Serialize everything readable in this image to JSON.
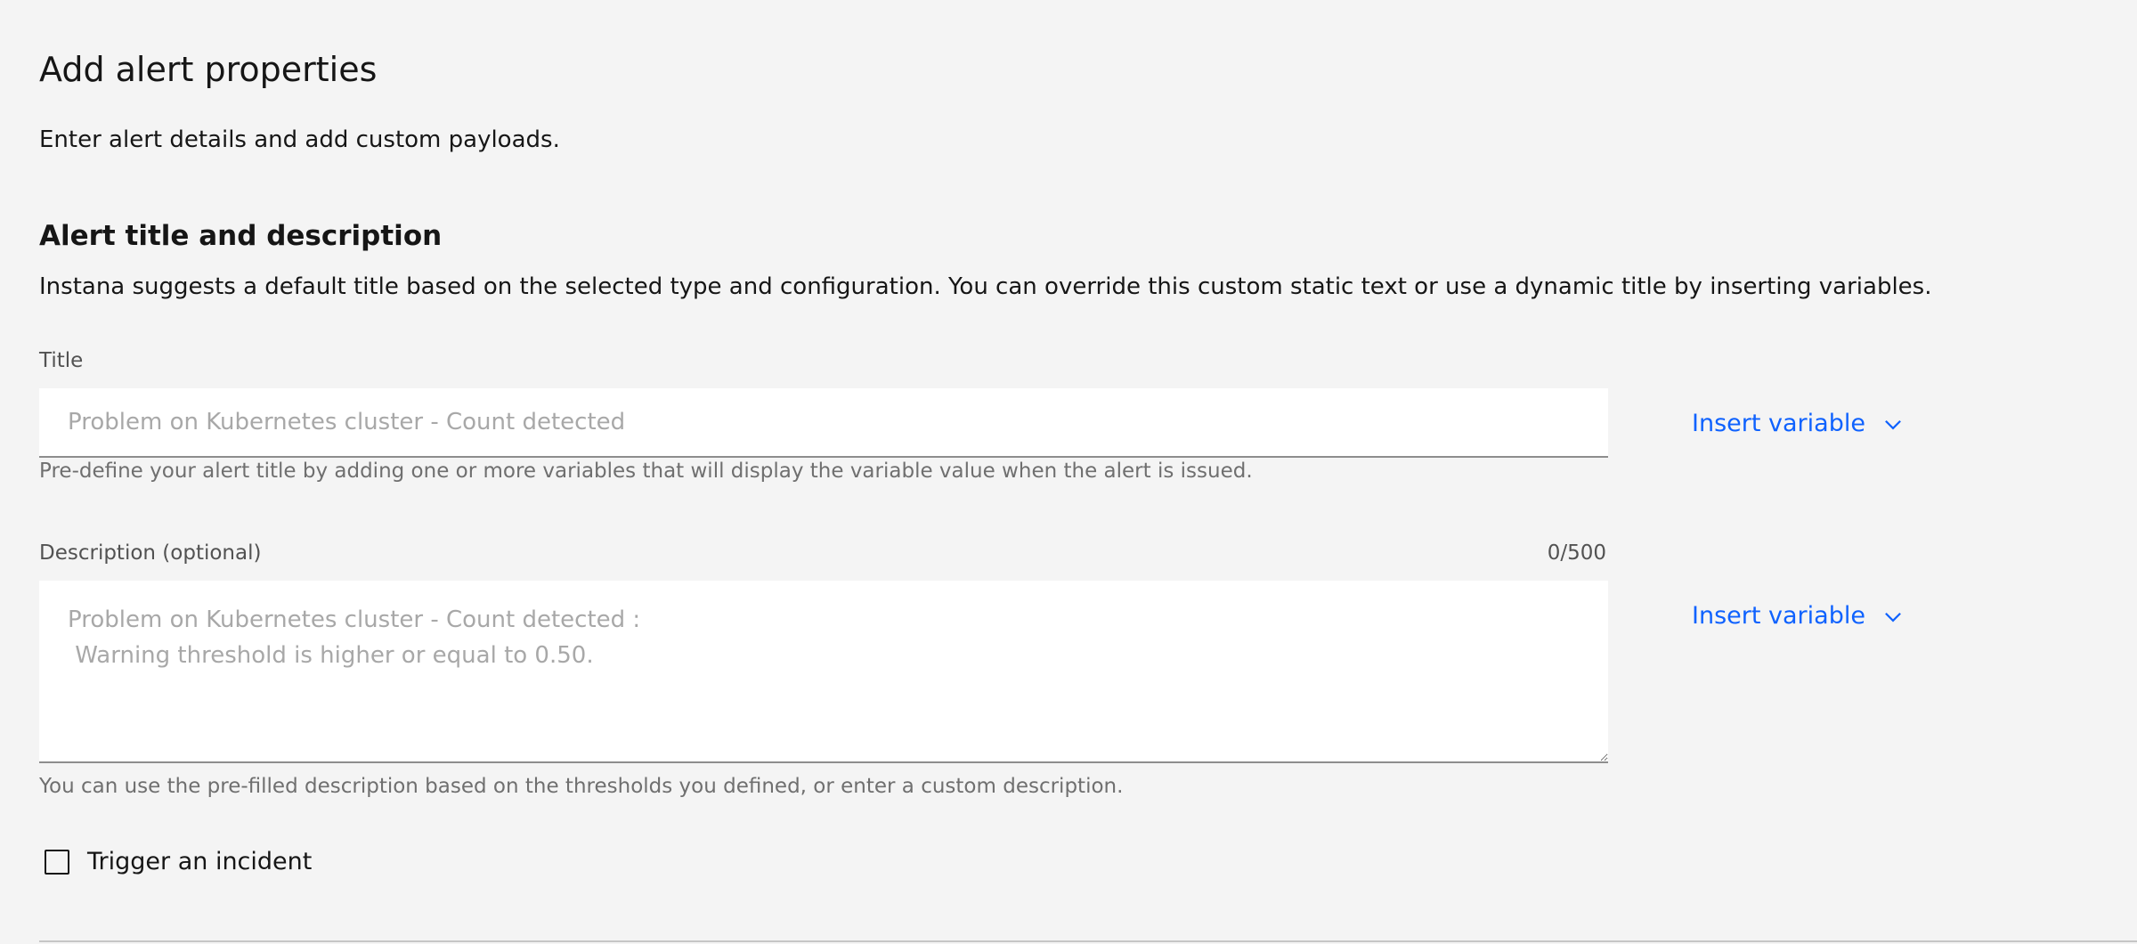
{
  "header": {
    "title": "Add alert properties",
    "subtitle": "Enter alert details and add custom payloads."
  },
  "section": {
    "title": "Alert title and description",
    "description": "Instana suggests a default title based on the selected type and configuration. You can override this custom static text or use a dynamic title by inserting variables."
  },
  "title_field": {
    "label": "Title",
    "value": "",
    "placeholder": "Problem on Kubernetes cluster - Count detected",
    "helper": "Pre-define your alert title by adding one or more variables that will display the variable value when the alert is issued.",
    "insert_variable_label": "Insert variable"
  },
  "description_field": {
    "label": "Description (optional)",
    "counter": "0/500",
    "value": "",
    "placeholder": "Problem on Kubernetes cluster - Count detected :\n Warning threshold is higher or equal to 0.50.",
    "helper": "You can use the pre-filled description based on the thresholds you defined, or enter a custom description.",
    "insert_variable_label": "Insert variable"
  },
  "incident": {
    "label": "Trigger an incident",
    "checked": false
  },
  "icons": {
    "insert_variable_chevron": "chevron-down-icon"
  },
  "colors": {
    "link": "#0f62fe",
    "background": "#f4f4f4",
    "field_background": "#ffffff",
    "placeholder": "#a8a8a8",
    "helper_text": "#6f6f6f"
  }
}
